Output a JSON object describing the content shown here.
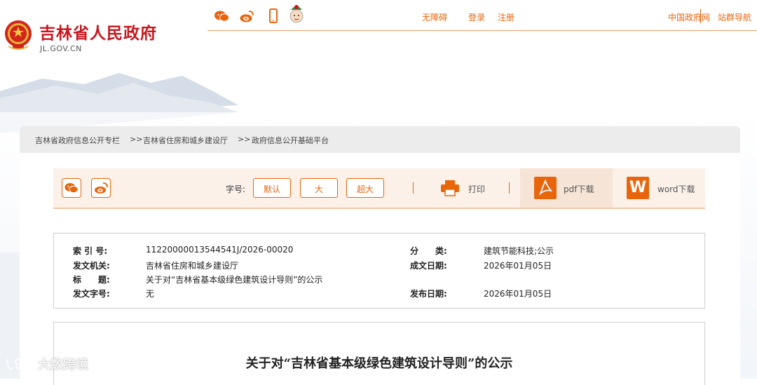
{
  "header": {
    "site_title": "吉林省人民政府",
    "site_domain": "JL.GOV.CN",
    "top_links": {
      "accessibility": "无障碍",
      "login": "登录",
      "register": "注册",
      "china_gov": "中国政府网",
      "site_nav": "站群导航"
    },
    "icons": [
      "wechat-icon",
      "weibo-icon",
      "mobile-icon",
      "mascot-icon"
    ]
  },
  "breadcrumb": {
    "items": [
      "吉林省政府信息公开专栏",
      "吉林省住房和城乡建设厅",
      "政府信息公开基础平台"
    ],
    "separator": ">>"
  },
  "toolbar": {
    "font_label": "字号:",
    "font_default": "默认",
    "font_large": "大",
    "font_xlarge": "超大",
    "print": "打印",
    "pdf_download": "pdf下载",
    "word_download": "word下载",
    "word_icon_letter": "W"
  },
  "meta": {
    "index_no_key": "索 引 号:",
    "index_no_val": "11220000013544541J/2026-00020",
    "category_key": "分　　类:",
    "category_val": "建筑节能科技;公示",
    "issuer_key": "发文机关:",
    "issuer_val": "吉林省住房和城乡建设厅",
    "date_made_key": "成文日期:",
    "date_made_val": "2026年01月05日",
    "title_key": "标　　题:",
    "title_val": "关于对“吉林省基本级绿色建筑设计导则”的公示",
    "doc_no_key": "发文字号:",
    "doc_no_val": "无",
    "publish_key": "发布日期:",
    "publish_val": "2026年01月05日"
  },
  "document": {
    "title": "关于对“吉林省基本级绿色建筑设计导则”的公示"
  },
  "watermark": {
    "text": "大数跨境"
  },
  "colors": {
    "brand_red": "#c8161d",
    "accent_orange": "#e8650c"
  }
}
